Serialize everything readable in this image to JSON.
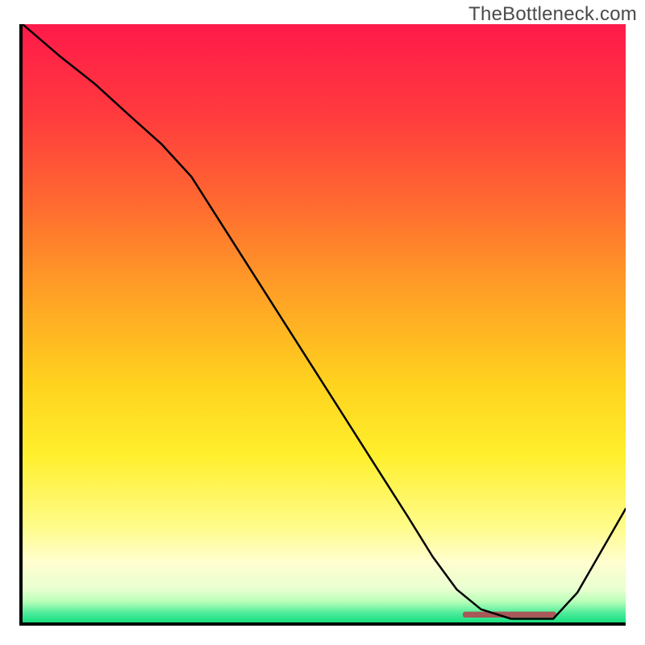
{
  "watermark": {
    "text": "TheBottleneck.com"
  },
  "gradient": {
    "stops": [
      {
        "pos": 0.0,
        "color": "#ff1a4a"
      },
      {
        "pos": 0.15,
        "color": "#ff3a3e"
      },
      {
        "pos": 0.3,
        "color": "#ff6a30"
      },
      {
        "pos": 0.45,
        "color": "#ffa126"
      },
      {
        "pos": 0.6,
        "color": "#ffd21e"
      },
      {
        "pos": 0.72,
        "color": "#ffef2c"
      },
      {
        "pos": 0.84,
        "color": "#fffc8a"
      },
      {
        "pos": 0.9,
        "color": "#fffed0"
      },
      {
        "pos": 0.945,
        "color": "#e8ffd0"
      },
      {
        "pos": 0.965,
        "color": "#b8ffb8"
      },
      {
        "pos": 0.985,
        "color": "#4beb9a"
      },
      {
        "pos": 1.0,
        "color": "#18e07e"
      }
    ]
  },
  "indicator_band": {
    "color": "#a85858",
    "y": 0.987,
    "x_start": 0.73,
    "x_end": 0.885,
    "thickness": 0.01
  },
  "chart_data": {
    "type": "line",
    "title": "",
    "xlabel": "",
    "ylabel": "",
    "xlim": [
      0,
      1
    ],
    "ylim": [
      0,
      1
    ],
    "grid": false,
    "legend": false,
    "series": [
      {
        "name": "curve",
        "x": [
          0.0,
          0.06,
          0.12,
          0.18,
          0.23,
          0.28,
          0.34,
          0.4,
          0.46,
          0.52,
          0.58,
          0.64,
          0.68,
          0.72,
          0.76,
          0.81,
          0.88,
          0.92,
          0.96,
          1.0
        ],
        "y": [
          1.0,
          0.948,
          0.9,
          0.845,
          0.8,
          0.745,
          0.65,
          0.555,
          0.46,
          0.365,
          0.27,
          0.175,
          0.11,
          0.055,
          0.022,
          0.006,
          0.006,
          0.05,
          0.12,
          0.19
        ]
      }
    ]
  }
}
